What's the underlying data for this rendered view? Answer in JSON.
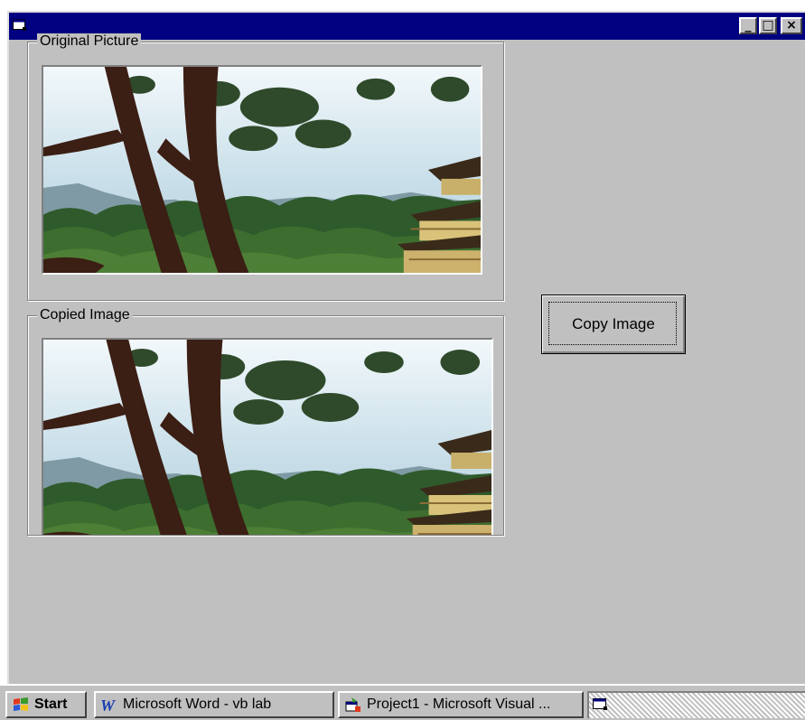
{
  "window": {
    "title": "",
    "icon": "form-icon",
    "title_bar_color": "#000080",
    "controls": {
      "minimize": "_",
      "maximize": "□",
      "close": "×"
    }
  },
  "original_frame": {
    "label": "Original Picture",
    "image": "photo-pine-tree-golden-pavilion"
  },
  "copied_frame": {
    "label": "Copied Image",
    "image": "photo-pine-tree-golden-pavilion-copy"
  },
  "copy_button": {
    "label": "Copy Image"
  },
  "taskbar": {
    "start_label": "Start",
    "items": [
      {
        "label": "Microsoft Word - vb lab",
        "icon": "word-icon"
      },
      {
        "label": "Project1 - Microsoft Visual ...",
        "icon": "visual-basic-icon"
      }
    ],
    "tray_icon": "form-icon"
  }
}
